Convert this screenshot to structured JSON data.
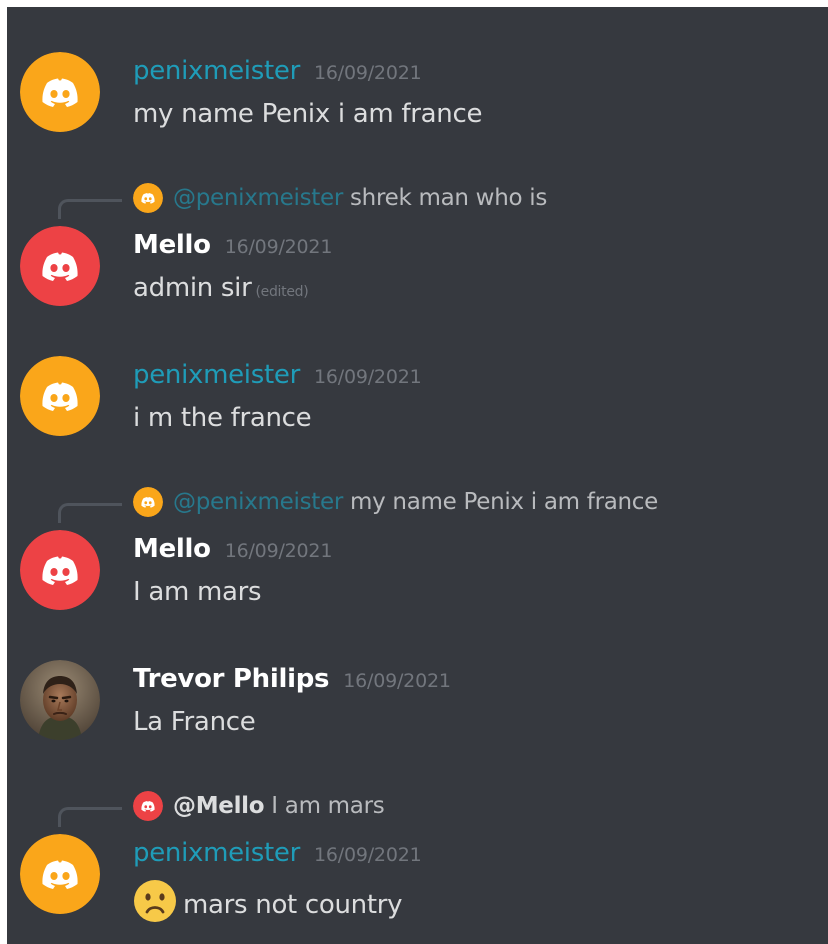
{
  "colors": {
    "background": "#36393f",
    "penix_name": "#1f9cb8",
    "mello_name": "#ffffff",
    "trevor_name": "#ffffff",
    "timestamp": "#72767d",
    "text": "#dcddde",
    "avatar_yellow": "#faa61a",
    "avatar_red": "#ed4245"
  },
  "messages": [
    {
      "author": "penixmeister",
      "timestamp": "16/09/2021",
      "text": "my name Penix i am france",
      "avatar_icon": "discord-logo-icon"
    },
    {
      "reply": {
        "mention": "@penixmeister",
        "text": "shrek man who is"
      },
      "author": "Mello",
      "timestamp": "16/09/2021",
      "text": "admin sir",
      "edited": "(edited)",
      "avatar_icon": "discord-logo-icon"
    },
    {
      "author": "penixmeister",
      "timestamp": "16/09/2021",
      "text": "i m the france",
      "avatar_icon": "discord-logo-icon"
    },
    {
      "reply": {
        "mention": "@penixmeister",
        "text": "my name Penix i am france"
      },
      "author": "Mello",
      "timestamp": "16/09/2021",
      "text": "I am mars",
      "avatar_icon": "discord-logo-icon"
    },
    {
      "author": "Trevor Philips",
      "timestamp": "16/09/2021",
      "text": "La France",
      "avatar_icon": "profile-photo"
    },
    {
      "reply": {
        "mention": "@Mello",
        "text": "I am mars"
      },
      "author": "penixmeister",
      "timestamp": "16/09/2021",
      "text": "mars not country",
      "emoji": "frowning-face-emoji",
      "avatar_icon": "discord-logo-icon"
    }
  ]
}
